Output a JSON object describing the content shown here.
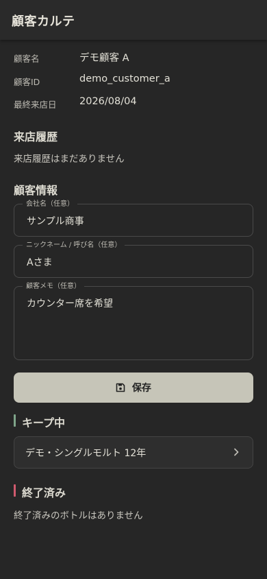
{
  "header": {
    "title": "顧客カルテ"
  },
  "customer": {
    "name_label": "顧客名",
    "name_value": "デモ顧客 A",
    "id_label": "顧客ID",
    "id_value": "demo_customer_a",
    "last_visit_label": "最終来店日",
    "last_visit_value": "2026/08/04"
  },
  "visit_history": {
    "title": "来店履歴",
    "empty_text": "来店履歴はまだありません"
  },
  "customer_info": {
    "title": "顧客情報",
    "company_label": "会社名（任意）",
    "company_value": "サンプル商事",
    "nickname_label": "ニックネーム / 呼び名（任意）",
    "nickname_value": "Aさま",
    "memo_label": "顧客メモ（任意）",
    "memo_value": "カウンター席を希望"
  },
  "save_button": {
    "label": "保存",
    "icon": "save-icon"
  },
  "keep": {
    "title": "キープ中",
    "accent_color": "#7fa58a",
    "items": [
      {
        "name": "デモ・シングルモルト 12年",
        "icon": "chevron-right-icon"
      }
    ]
  },
  "finished": {
    "title": "終了済み",
    "accent_color": "#d05a6e",
    "empty_text": "終了済みのボトルはありません"
  },
  "colors": {
    "background": "#262626",
    "header_background": "#2a2a2a",
    "button_background": "#c6c5b8",
    "text_primary": "#e4e2d8",
    "text_secondary": "#bdbbb3",
    "field_border": "#4a4a4a"
  }
}
